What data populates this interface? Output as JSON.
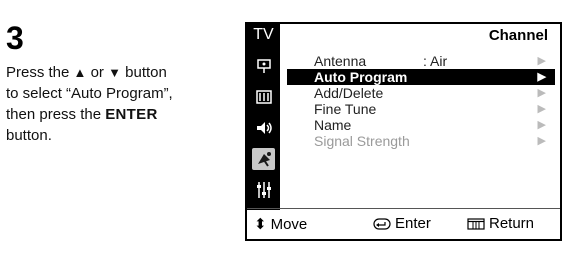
{
  "step": {
    "number": "3",
    "line1_prefix": "Press the ",
    "up_glyph": "▲",
    "or_word": " or ",
    "down_glyph": "▼",
    "line1_suffix": " button",
    "line2": "to select “Auto Program”,",
    "line3_prefix": "then press the ",
    "enter_bold": "ENTER",
    "line4": "button."
  },
  "osd": {
    "tv_label": "TV",
    "title": "Channel",
    "side_icons": [
      "antenna-input-icon",
      "picture-icon",
      "sound-icon",
      "channel-satellite-icon",
      "setup-icon"
    ],
    "menu_items": [
      {
        "label": "Antenna",
        "value": ":  Air",
        "arrow": "▶",
        "state": "normal"
      },
      {
        "label": "Auto Program",
        "value": "",
        "arrow": "▶",
        "state": "selected"
      },
      {
        "label": "Add/Delete",
        "value": "",
        "arrow": "▶",
        "state": "normal"
      },
      {
        "label": "Fine Tune",
        "value": "",
        "arrow": "▶",
        "state": "normal"
      },
      {
        "label": "Name",
        "value": "",
        "arrow": "▶",
        "state": "normal"
      },
      {
        "label": "Signal Strength",
        "value": "",
        "arrow": "▶",
        "state": "dim"
      }
    ],
    "footer": {
      "move_glyph": "⬍",
      "move_label": "Move",
      "enter_label": "Enter",
      "return_label": "Return"
    }
  }
}
